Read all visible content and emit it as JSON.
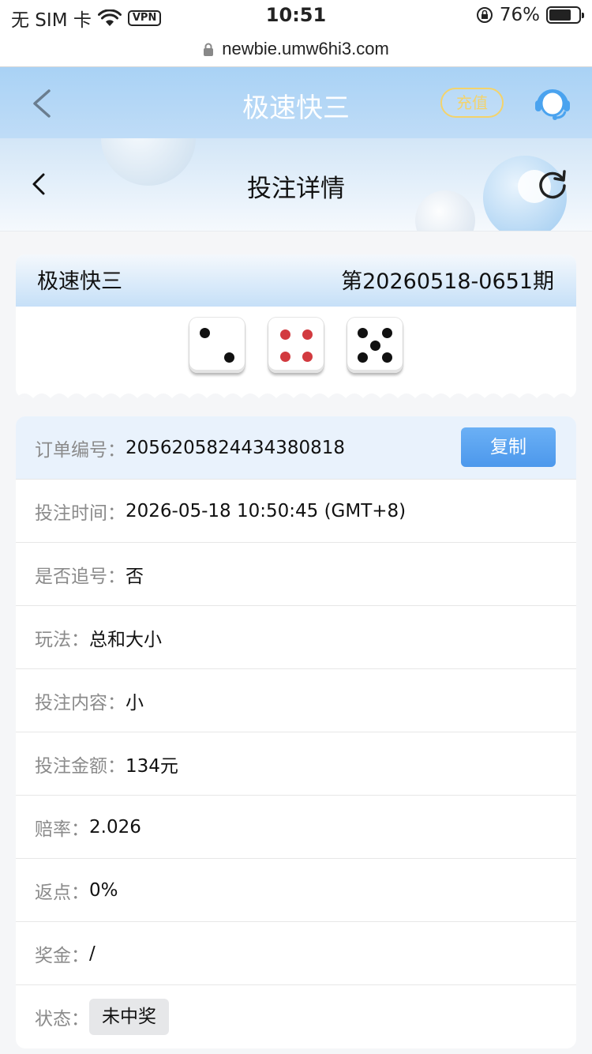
{
  "status_bar": {
    "carrier": "无 SIM 卡",
    "vpn": "VPN",
    "time": "10:51",
    "battery": "76%",
    "battery_level": 0.76
  },
  "browser": {
    "url": "newbie.umw6hi3.com"
  },
  "app_header": {
    "title": "极速快三",
    "recharge_label": "充值"
  },
  "sub_header": {
    "title": "投注详情"
  },
  "result": {
    "game": "极速快三",
    "issue": "第20260518-0651期",
    "dice": [
      2,
      4,
      5
    ]
  },
  "details": {
    "order_no_label": "订单编号：",
    "order_no": "2056205824434380818",
    "copy_label": "复制",
    "bet_time_label": "投注时间：",
    "bet_time": "2026-05-18 10:50:45 (GMT+8)",
    "chase_label": "是否追号：",
    "chase": "否",
    "play_label": "玩法：",
    "play": "总和大小",
    "content_label": "投注内容：",
    "content": "小",
    "amount_label": "投注金额：",
    "amount": "134元",
    "odds_label": "赔率：",
    "odds": "2.026",
    "rebate_label": "返点：",
    "rebate": "0%",
    "prize_label": "奖金：",
    "prize": "/",
    "status_label": "状态：",
    "status": "未中奖"
  },
  "colors": {
    "header_bg": "#a9d2f5",
    "copy_button": "#4c98ec",
    "recharge_border": "#f3d36c",
    "red_pip": "#d23a3f"
  },
  "icons": [
    "wifi-icon",
    "lock-icon",
    "battery-icon",
    "back-chevron-icon",
    "headset-icon",
    "refresh-icon",
    "die-icon"
  ]
}
